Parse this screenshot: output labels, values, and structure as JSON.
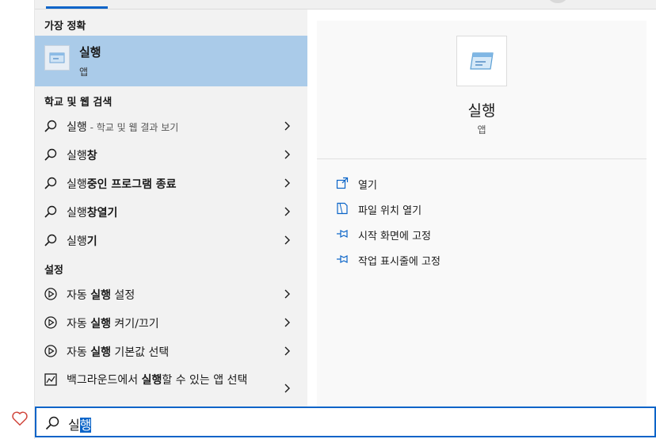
{
  "window": {
    "accent": "#0a64c8"
  },
  "results": {
    "best_match_header": "가장 정확",
    "best_match": {
      "title": "실행",
      "subtitle": "앱",
      "icon": "run-app-icon"
    },
    "web_header": "학교 및 웹 검색",
    "web_items": [
      {
        "plain": "실행",
        "hint": " - 학교 및 웹 결과 보기",
        "bold": ""
      },
      {
        "plain": "실행",
        "hint": "",
        "bold": "창"
      },
      {
        "plain": "실행",
        "hint": "",
        "bold": "중인 프로그램 종료"
      },
      {
        "plain": "실행",
        "hint": "",
        "bold": "창열기"
      },
      {
        "plain": "실행",
        "hint": "",
        "bold": "기"
      }
    ],
    "settings_header": "설정",
    "settings_items": [
      {
        "pre": "자동 ",
        "bold": "실행",
        "post": " 설정"
      },
      {
        "pre": "자동 ",
        "bold": "실행",
        "post": " 켜기/끄기"
      },
      {
        "pre": "자동 ",
        "bold": "실행",
        "post": " 기본값 선택"
      },
      {
        "pre": "백그라운드에서 ",
        "bold": "실행",
        "post": "할 수 있는 앱 선택"
      }
    ]
  },
  "detail": {
    "title": "실행",
    "subtitle": "앱",
    "actions": [
      {
        "label": "열기",
        "icon": "open-icon"
      },
      {
        "label": "파일 위치 열기",
        "icon": "file-location-icon"
      },
      {
        "label": "시작 화면에 고정",
        "icon": "pin-icon"
      },
      {
        "label": "작업 표시줄에 고정",
        "icon": "pin-icon"
      }
    ]
  },
  "search": {
    "typed": "실",
    "selected": "행"
  }
}
